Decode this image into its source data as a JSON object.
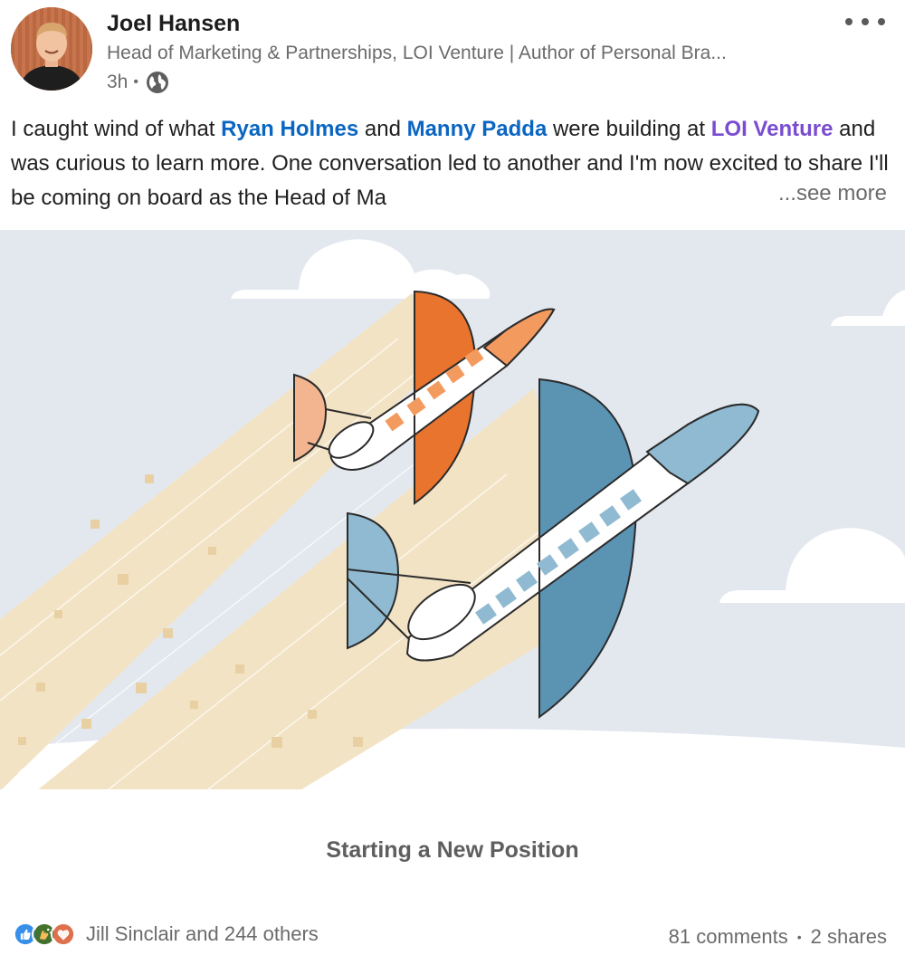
{
  "author": {
    "name": "Joel Hansen",
    "headline": "Head of Marketing & Partnerships, LOI Venture | Author of Personal Bra...",
    "time": "3h",
    "visibility_icon": "globe-icon"
  },
  "post": {
    "text_1": "I caught wind of what ",
    "mention_1": "Ryan Holmes",
    "text_2": " and ",
    "mention_2": "Manny Padda",
    "text_3": " were building at ",
    "company": "LOI Venture",
    "text_4": " and was curious to learn more. One conversation led to another and I'm now excited to share I'll be coming on board as the Head of Ma",
    "see_more": "...see more"
  },
  "image": {
    "caption": "Starting a New Position"
  },
  "social": {
    "reactions": [
      "like-icon",
      "celebrate-icon",
      "love-icon"
    ],
    "reactors_text": "Jill Sinclair and 244 others",
    "comments": "81 comments",
    "shares": "2 shares"
  },
  "colors": {
    "mention": "#0a66c2",
    "company": "#7a4cd1",
    "plane_orange": "#e8742e",
    "plane_blue": "#5b93b3",
    "sky": "#e3e8ef",
    "trail": "#f2e2c4"
  }
}
